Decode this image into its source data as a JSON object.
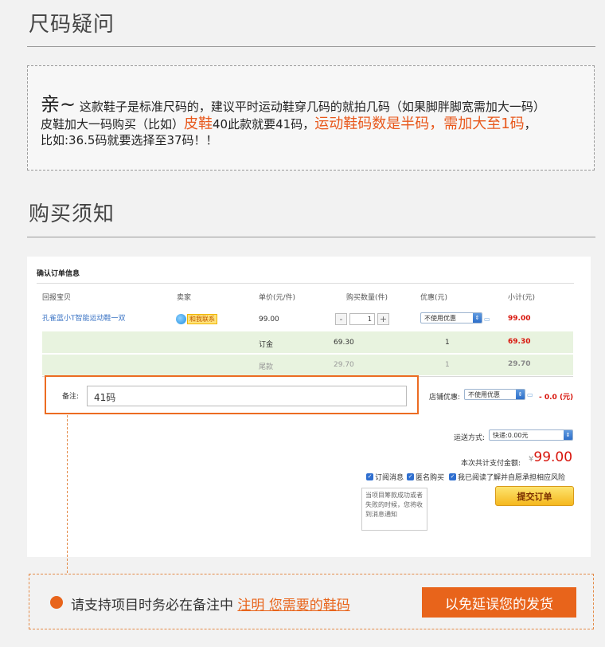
{
  "size_section": {
    "title": "尺码疑问",
    "note": {
      "greet": "亲~",
      "line1": "这款鞋子是标准尺码的，建议平时运动鞋穿几码的就拍几码（如果脚胖脚宽需加大一码）",
      "line2_a": "皮鞋加大一码购买（比如）",
      "line2_b": "皮鞋",
      "line2_c": "40此款就要41码，",
      "line2_d": "运动鞋码数是半码，需加大至1码",
      "line2_e": "，",
      "line3": "比如:36.5码就要选择至37码！！"
    }
  },
  "purchase_section": {
    "title": "购买须知"
  },
  "order": {
    "title": "确认订单信息",
    "headers": [
      "回报宝贝",
      "卖家",
      "单价(元/件)",
      "购买数量(件)",
      "优惠(元)",
      "小计(元)"
    ],
    "item": {
      "name": "孔雀蓝小T智能运动鞋一双",
      "contact_label": "和我联系",
      "unit_price": "99.00",
      "quantity": "1",
      "discount_select": "不使用优惠",
      "subtotal": "99.00"
    },
    "deposit_row": {
      "label": "订金",
      "price": "69.30",
      "qty": "1",
      "subtotal": "69.30"
    },
    "balance_row": {
      "label": "尾款",
      "price": "29.70",
      "qty": "1",
      "subtotal": "29.70"
    },
    "remark": {
      "label": "备注:",
      "value": "41码"
    },
    "shop_discount": {
      "label": "店铺优惠:",
      "select": "不使用优惠",
      "amount": "- 0.0 (元)"
    },
    "shipping": {
      "label": "运送方式:",
      "select": "快递:0.00元"
    },
    "total": {
      "label": "本次共计支付金额:",
      "currency": "¥",
      "amount": "99.00"
    },
    "checks": [
      "订阅消息",
      "匿名购买",
      "我已阅读了解并自愿承担相应风险"
    ],
    "submit_label": "提交订单",
    "tooltip": "当项目筹款成功或者失败的时候，您将收到消息通知"
  },
  "footer": {
    "text_a": "请支持项目时务必在备注中",
    "text_link": "注明 您需要的鞋码",
    "button": "以免延误您的发货"
  },
  "colors": {
    "accent": "#e8641b",
    "price_red": "#d8150c",
    "link_blue": "#3a73c4"
  }
}
